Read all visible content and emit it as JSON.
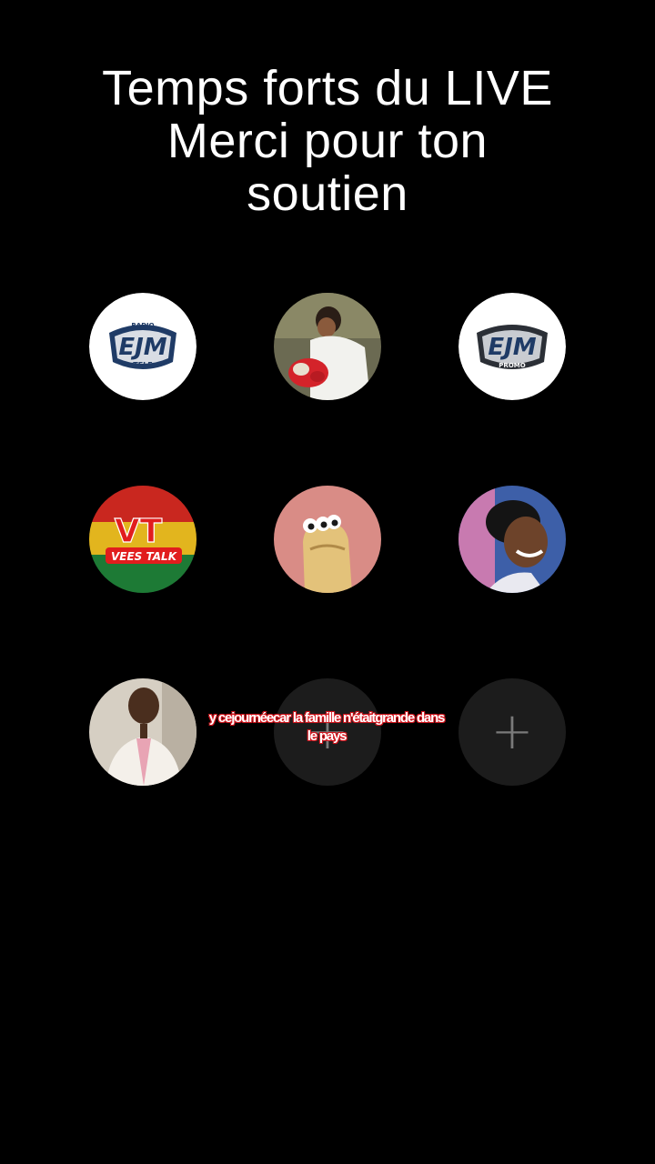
{
  "title": {
    "line1": "Temps forts du LIVE",
    "line2": "Merci pour ton",
    "line3": "soutien"
  },
  "supporters": [
    {
      "name": "EJM Radio Tele logo",
      "logo_top": "RADIO",
      "logo_main": "EJM",
      "logo_bottom": "TELE"
    },
    {
      "name": "supporter with flowers"
    },
    {
      "name": "EJM Promo logo",
      "logo_main": "EJM",
      "logo_bottom": "PROMO"
    },
    {
      "name": "Vees Talk logo",
      "logo_main": "VT",
      "logo_bottom": "VEES TALK"
    },
    {
      "name": "cartoon character"
    },
    {
      "name": "smiling supporter"
    },
    {
      "name": "man in white suit"
    }
  ],
  "add_slots": [
    {
      "icon": "plus-icon",
      "glyph": "+"
    },
    {
      "icon": "plus-icon",
      "glyph": "+"
    }
  ],
  "caption": "y cejournéecar la famille n'étaitgrande dans le pays",
  "colors": {
    "background": "#000000",
    "slot": "#1c1c1c",
    "plus": "#7a7a7a",
    "caption_outline": "#d2141c"
  }
}
